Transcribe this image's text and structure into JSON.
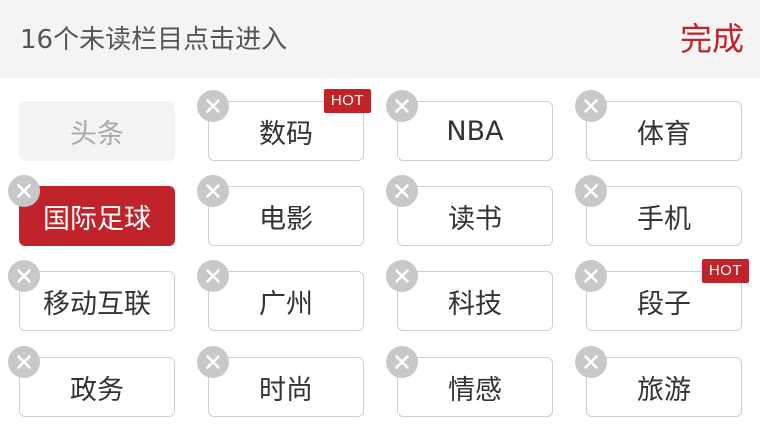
{
  "header": {
    "title": "16个未读栏目点击进入",
    "done_label": "完成"
  },
  "colors": {
    "accent": "#c0242a",
    "header_bg": "#f4f4f4",
    "chip_border": "#cfcfcf",
    "remove_icon": "#c8c8c8"
  },
  "channels": [
    {
      "label": "头条",
      "state": "fixed",
      "removable": false,
      "badge": ""
    },
    {
      "label": "数码",
      "state": "normal",
      "removable": true,
      "badge": "HOT"
    },
    {
      "label": "NBA",
      "state": "normal",
      "removable": true,
      "badge": ""
    },
    {
      "label": "体育",
      "state": "normal",
      "removable": true,
      "badge": ""
    },
    {
      "label": "国际足球",
      "state": "selected",
      "removable": true,
      "badge": ""
    },
    {
      "label": "电影",
      "state": "normal",
      "removable": true,
      "badge": ""
    },
    {
      "label": "读书",
      "state": "normal",
      "removable": true,
      "badge": ""
    },
    {
      "label": "手机",
      "state": "normal",
      "removable": true,
      "badge": ""
    },
    {
      "label": "移动互联",
      "state": "normal",
      "removable": true,
      "badge": ""
    },
    {
      "label": "广州",
      "state": "normal",
      "removable": true,
      "badge": ""
    },
    {
      "label": "科技",
      "state": "normal",
      "removable": true,
      "badge": ""
    },
    {
      "label": "段子",
      "state": "normal",
      "removable": true,
      "badge": "HOT"
    },
    {
      "label": "政务",
      "state": "normal",
      "removable": true,
      "badge": ""
    },
    {
      "label": "时尚",
      "state": "normal",
      "removable": true,
      "badge": ""
    },
    {
      "label": "情感",
      "state": "normal",
      "removable": true,
      "badge": ""
    },
    {
      "label": "旅游",
      "state": "normal",
      "removable": true,
      "badge": ""
    }
  ]
}
